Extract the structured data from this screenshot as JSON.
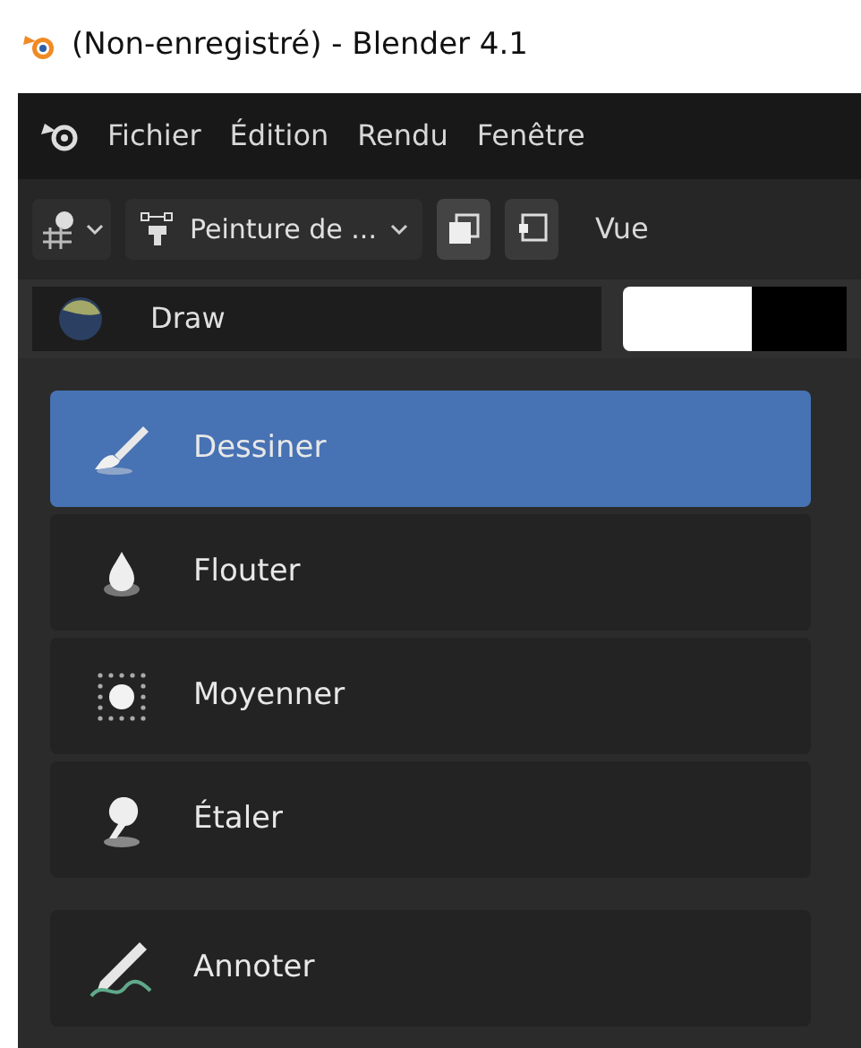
{
  "window": {
    "title": "(Non-enregistré) - Blender 4.1"
  },
  "menu": [
    "Fichier",
    "Édition",
    "Rendu",
    "Fenêtre"
  ],
  "header": {
    "mode": "Peinture de ...",
    "view": "Vue"
  },
  "brush": {
    "name": "Draw",
    "colors": [
      {
        "color": "#ffffff"
      },
      {
        "color": "#000000"
      }
    ]
  },
  "tool_groups": [
    [
      {
        "label": "Dessiner",
        "kind": "draw",
        "selected": true
      },
      {
        "label": "Flouter",
        "kind": "blur",
        "selected": false
      },
      {
        "label": "Moyenner",
        "kind": "average",
        "selected": false
      },
      {
        "label": "Étaler",
        "kind": "smear",
        "selected": false
      }
    ],
    [
      {
        "label": "Annoter",
        "kind": "annotate",
        "selected": false
      }
    ]
  ]
}
